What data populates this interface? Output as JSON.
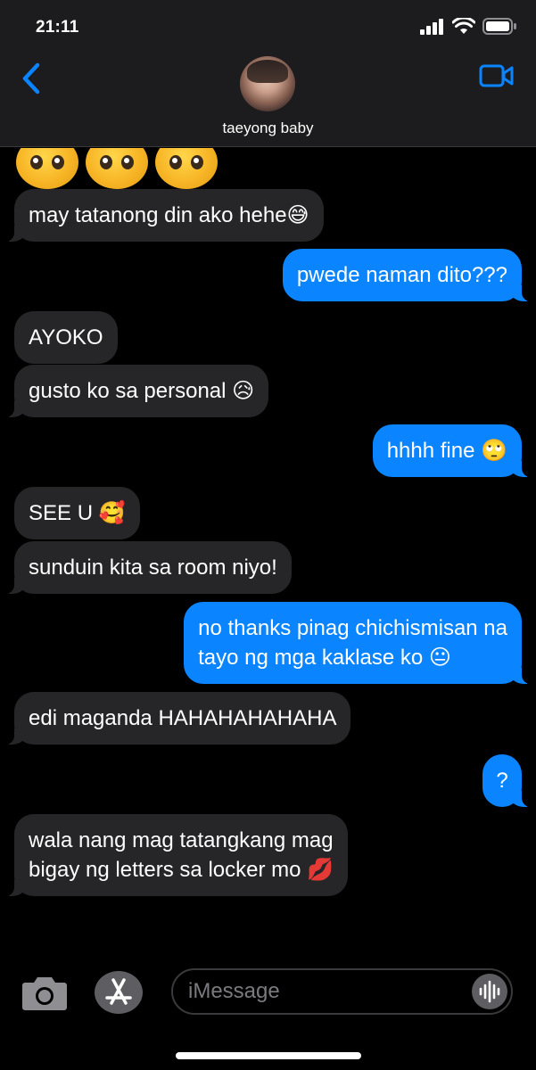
{
  "status_bar": {
    "time": "21:11"
  },
  "header": {
    "contact_name": "taeyong baby",
    "back_icon": "chevron-left-icon",
    "video_icon": "video-camera-icon",
    "accent": "#0a84ff"
  },
  "messages": [
    {
      "from": "them",
      "text": "may tatanong din ako hehe😅"
    },
    {
      "from": "me",
      "text": "pwede naman dito???"
    },
    {
      "from": "them",
      "text": "AYOKO"
    },
    {
      "from": "them",
      "text": "gusto ko sa personal 😥"
    },
    {
      "from": "me",
      "text": "hhhh fine 🙄"
    },
    {
      "from": "them",
      "text": "SEE U 🥰"
    },
    {
      "from": "them",
      "text": "sunduin kita sa room niyo!"
    },
    {
      "from": "me",
      "line1": "no thanks pinag chichismisan na",
      "line2": "tayo ng mga kaklase ko 😐"
    },
    {
      "from": "them",
      "text": "edi maganda HAHAHAHAHAHA"
    },
    {
      "from": "me",
      "text": "?"
    },
    {
      "from": "them",
      "line1": "wala nang mag tatangkang mag",
      "line2": "bigay ng letters sa locker mo 💋"
    }
  ],
  "input_bar": {
    "placeholder": "iMessage",
    "camera_icon": "camera-icon",
    "apps_icon": "app-store-icon",
    "audio_icon": "audio-waveform-icon"
  },
  "colors": {
    "incoming_bubble": "#262628",
    "outgoing_bubble": "#0a84ff",
    "background": "#000000",
    "header_bg": "#1c1c1e"
  }
}
